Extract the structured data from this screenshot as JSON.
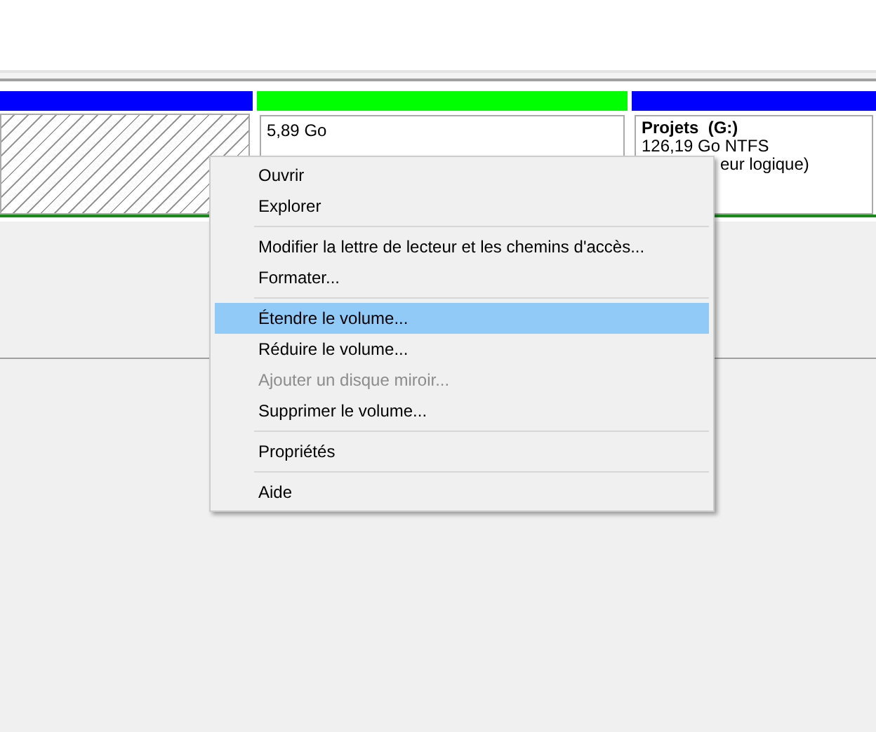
{
  "disk": {
    "partitions": [
      {
        "kind": "unallocated",
        "color": "#0000ff"
      },
      {
        "kind": "volume",
        "color": "#00ff00",
        "lines": [
          "5,89 Go"
        ]
      },
      {
        "kind": "volume",
        "color": "#0000ff",
        "title": "Projets  (G:)",
        "lines": [
          "126,19 Go NTFS"
        ],
        "partial": "eur logique)"
      }
    ]
  },
  "context_menu": {
    "items": [
      {
        "kind": "item",
        "label": "Ouvrir",
        "selected": false,
        "disabled": false
      },
      {
        "kind": "item",
        "label": "Explorer",
        "selected": false,
        "disabled": false
      },
      {
        "kind": "separator"
      },
      {
        "kind": "item",
        "label": "Modifier la lettre de lecteur et les chemins d'accès...",
        "selected": false,
        "disabled": false
      },
      {
        "kind": "item",
        "label": "Formater...",
        "selected": false,
        "disabled": false
      },
      {
        "kind": "separator"
      },
      {
        "kind": "item",
        "label": "Étendre le volume...",
        "selected": true,
        "disabled": false
      },
      {
        "kind": "item",
        "label": "Réduire le volume...",
        "selected": false,
        "disabled": false
      },
      {
        "kind": "item",
        "label": "Ajouter un disque miroir...",
        "selected": false,
        "disabled": true
      },
      {
        "kind": "item",
        "label": "Supprimer le volume...",
        "selected": false,
        "disabled": false
      },
      {
        "kind": "separator"
      },
      {
        "kind": "item",
        "label": "Propriétés",
        "selected": false,
        "disabled": false
      },
      {
        "kind": "separator"
      },
      {
        "kind": "item",
        "label": "Aide",
        "selected": false,
        "disabled": false
      }
    ]
  }
}
